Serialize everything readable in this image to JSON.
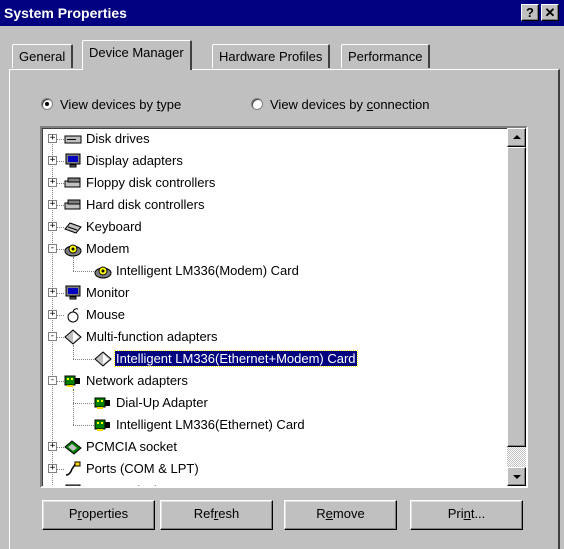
{
  "window": {
    "title": "System Properties",
    "help_label": "?",
    "close_label": "✕"
  },
  "tabs": [
    {
      "label": "General",
      "active": false
    },
    {
      "label": "Device Manager",
      "active": true
    },
    {
      "label": "Hardware Profiles",
      "active": false
    },
    {
      "label": "Performance",
      "active": false
    }
  ],
  "view": {
    "by_type": {
      "label_pre": "View devices by ",
      "label_key": "t",
      "label_post": "ype",
      "selected": true
    },
    "by_connection": {
      "label_pre": "View devices by ",
      "label_key": "c",
      "label_post": "onnection",
      "selected": false
    }
  },
  "tree": [
    {
      "label": "Disk drives",
      "level": 0,
      "expander": "+",
      "icon": "disk-drive-icon"
    },
    {
      "label": "Display adapters",
      "level": 0,
      "expander": "+",
      "icon": "monitor-icon"
    },
    {
      "label": "Floppy disk controllers",
      "level": 0,
      "expander": "+",
      "icon": "floppy-controller-icon"
    },
    {
      "label": "Hard disk controllers",
      "level": 0,
      "expander": "+",
      "icon": "hard-disk-controller-icon"
    },
    {
      "label": "Keyboard",
      "level": 0,
      "expander": "+",
      "icon": "keyboard-icon"
    },
    {
      "label": "Modem",
      "level": 0,
      "expander": "-",
      "icon": "modem-icon"
    },
    {
      "label": "Intelligent LM336(Modem) Card",
      "level": 1,
      "expander": "",
      "icon": "modem-icon"
    },
    {
      "label": "Monitor",
      "level": 0,
      "expander": "+",
      "icon": "monitor-icon"
    },
    {
      "label": "Mouse",
      "level": 0,
      "expander": "+",
      "icon": "mouse-icon"
    },
    {
      "label": "Multi-function adapters",
      "level": 0,
      "expander": "-",
      "icon": "multifunction-icon"
    },
    {
      "label": "Intelligent LM336(Ethernet+Modem) Card",
      "level": 1,
      "expander": "",
      "icon": "multifunction-icon",
      "selected": true
    },
    {
      "label": "Network adapters",
      "level": 0,
      "expander": "-",
      "icon": "network-adapter-icon"
    },
    {
      "label": "Dial-Up Adapter",
      "level": 1,
      "expander": "",
      "icon": "network-adapter-icon"
    },
    {
      "label": "Intelligent LM336(Ethernet) Card",
      "level": 1,
      "expander": "",
      "icon": "network-adapter-icon"
    },
    {
      "label": "PCMCIA socket",
      "level": 0,
      "expander": "+",
      "icon": "pcmcia-icon"
    },
    {
      "label": "Ports (COM & LPT)",
      "level": 0,
      "expander": "+",
      "icon": "port-icon"
    },
    {
      "label": "System devices",
      "level": 0,
      "expander": "+",
      "icon": "system-devices-icon"
    }
  ],
  "buttons": {
    "properties": {
      "pre": "P",
      "key": "r",
      "post": "operties"
    },
    "refresh": {
      "pre": "Ref",
      "key": "r",
      "post": "esh"
    },
    "remove": {
      "pre": "R",
      "key": "e",
      "post": "move"
    },
    "print": {
      "pre": "Pri",
      "key": "n",
      "post": "t..."
    }
  },
  "colors": {
    "titlebar": "#000080",
    "face": "#c0c0c0",
    "selection": "#000080"
  }
}
